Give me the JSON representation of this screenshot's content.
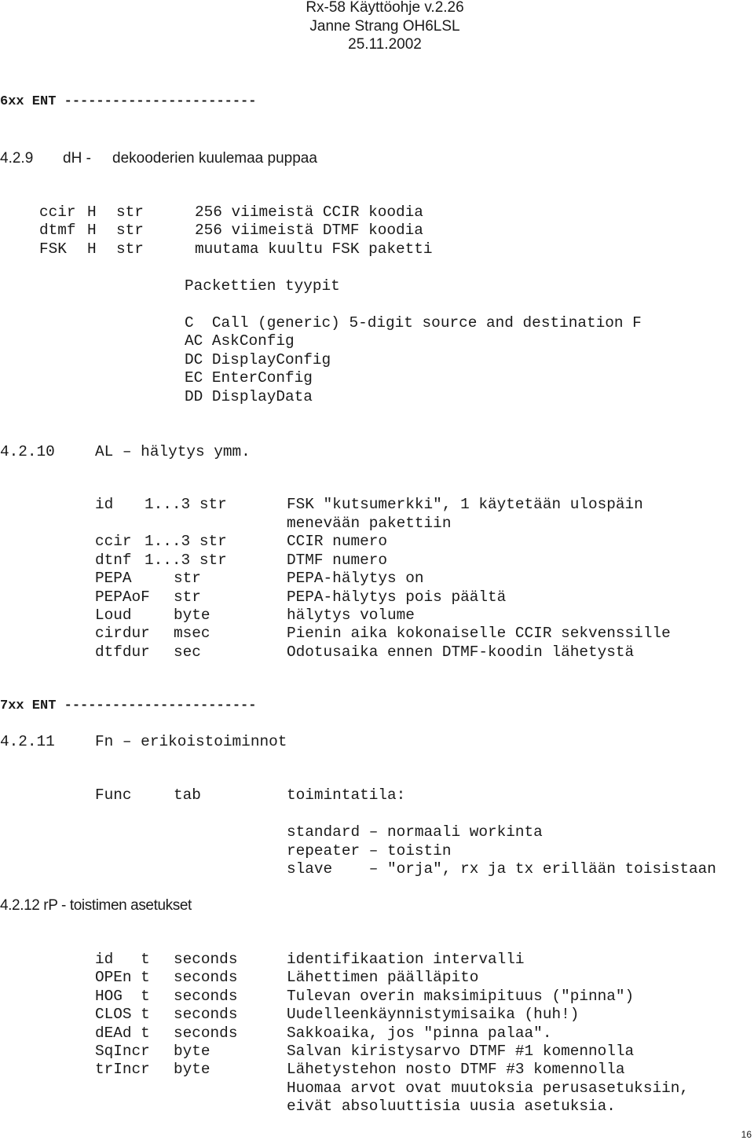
{
  "header": {
    "title": "Rx-58 Käyttöohje v.2.26",
    "author": "Janne Strang OH6LSL",
    "date": "25.11.2002"
  },
  "sections": {
    "ent6": "6xx ENT ------------------------",
    "s429": {
      "number": "4.2.9",
      "code": "dH -",
      "title": "dekooderien kuulemaa puppaa",
      "rows": [
        {
          "name": "ccir",
          "flag": "H",
          "type": "str",
          "desc": "256 viimeistä CCIR koodia"
        },
        {
          "name": "dtmf",
          "flag": "H",
          "type": "str",
          "desc": "256 viimeistä DTMF koodia"
        },
        {
          "name": "FSK",
          "flag": "H",
          "type": "str",
          "desc": "muutama kuultu FSK paketti"
        }
      ],
      "packet_heading": "Packettien tyypit",
      "packets": [
        "C  Call (generic) 5-digit source and destination F",
        "AC AskConfig",
        "DC DisplayConfig",
        "EC EnterConfig",
        "DD DisplayData"
      ]
    },
    "s4210": {
      "number": "4.2.10",
      "title": "AL – hälytys ymm.",
      "rows": [
        {
          "name": "id",
          "type": "1...3 str",
          "desc": "FSK \"kutsumerkki\", 1 käytetään ulospäin"
        },
        {
          "name": "",
          "type": "",
          "desc": "menevään pakettiin"
        },
        {
          "name": "ccir",
          "type": "1...3 str",
          "desc": "CCIR numero"
        },
        {
          "name": "dtnf",
          "type": "1...3 str",
          "desc": "DTMF numero"
        },
        {
          "name": "PEPA",
          "type": "str",
          "desc": "PEPA-hälytys on"
        },
        {
          "name": "PEPAoF",
          "type": "str",
          "desc": "PEPA-hälytys pois päältä"
        },
        {
          "name": "Loud",
          "type": "byte",
          "desc": "hälytys volume"
        },
        {
          "name": "cirdur",
          "type": "msec",
          "desc": "Pienin aika kokonaiselle CCIR sekvenssille"
        },
        {
          "name": "dtfdur",
          "type": "sec",
          "desc": "Odotusaika ennen DTMF-koodin lähetystä"
        }
      ]
    },
    "ent7": "7xx ENT ------------------------",
    "s4211": {
      "number": "4.2.11",
      "title": "Fn – erikoistoiminnot",
      "func": "Func",
      "tab": "tab",
      "mode_label": "toimintatila:",
      "modes": [
        "standard – normaali workinta",
        "repeater – toistin",
        "slave    – \"orja\", rx ja tx erillään toisistaan"
      ]
    },
    "s4212": {
      "heading": "4.2.12 rP - toistimen asetukset",
      "rows": [
        {
          "name": "id   t",
          "type": "seconds",
          "desc": "identifikaation intervalli"
        },
        {
          "name": "OPEn t",
          "type": "seconds",
          "desc": "Lähettimen päälläpito"
        },
        {
          "name": "HOG  t",
          "type": "seconds",
          "desc": "Tulevan overin maksimipituus (\"pinna\")"
        },
        {
          "name": "CLOS t",
          "type": "seconds",
          "desc": "Uudelleenkäynnistymisaika (huh!)"
        },
        {
          "name": "dEAd t",
          "type": "seconds",
          "desc": "Sakkoaika, jos \"pinna palaa\"."
        },
        {
          "name": "SqIncr",
          "type": "byte",
          "desc": "Salvan kiristysarvo DTMF #1 komennolla"
        },
        {
          "name": "trIncr",
          "type": "byte",
          "desc": "Lähetystehon nosto DTMF #3 komennolla"
        },
        {
          "name": "",
          "type": "",
          "desc": "Huomaa arvot ovat muutoksia perusasetuksiin,"
        },
        {
          "name": "",
          "type": "",
          "desc": "eivät absoluuttisia uusia asetuksia."
        }
      ]
    }
  },
  "footer": {
    "page_number": "16"
  }
}
